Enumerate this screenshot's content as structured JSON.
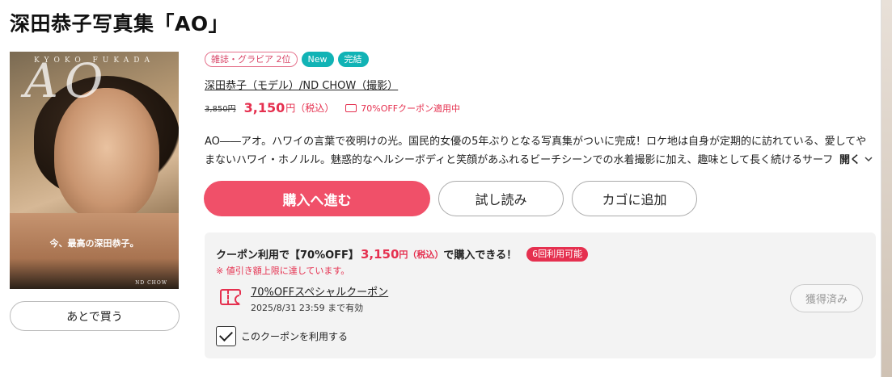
{
  "page": {
    "title": "深田恭子写真集「AO」"
  },
  "cover": {
    "top_text": "KYOKO FUKADA",
    "ao_text": "AO",
    "caption": "今、最高の深田恭子。",
    "foot_text": "ND CHOW"
  },
  "actions": {
    "later_label": "あとで買う",
    "buy_label": "購入へ進む",
    "trial_label": "試し読み",
    "cart_label": "カゴに追加"
  },
  "tags": {
    "rank": "雑誌・グラビア 2位",
    "new": "New",
    "completed": "完結"
  },
  "authors": "深田恭子（モデル）/ND CHOW（撮影）",
  "price": {
    "original": "3,850円",
    "sale": "3,150",
    "sale_unit": "円（税込）",
    "coupon_note": "70%OFFクーポン適用中"
  },
  "description": {
    "text": "AO――アオ。ハワイの言葉で夜明けの光。国民的女優の5年ぶりとなる写真集がついに完成！ロケ地は自身が定期的に訪れている、愛してやまないハワイ・ホノルル。魅惑的なヘルシーボディと笑顔があふれるビーチシーンでの水着撮影に加え、趣味として長く続けるサーフィ",
    "open_label": "開く"
  },
  "coupon": {
    "headline_prefix": "クーポン利用で【70%OFF】",
    "headline_price": "3,150",
    "headline_unit": "円（税込）",
    "headline_suffix": "で購入できる！",
    "badge": "6回利用可能",
    "warning": "※ 値引き額上限に達しています。",
    "name": "70%OFFスペシャルクーポン",
    "expiry": "2025/8/31 23:59 まで有効",
    "acquired_label": "獲得済み",
    "use_label": "このクーポンを利用する",
    "use_checked": true
  },
  "colors": {
    "accent_red": "#e5304f",
    "buy_button": "#f05069",
    "teal_badge": "#11b3b5"
  }
}
